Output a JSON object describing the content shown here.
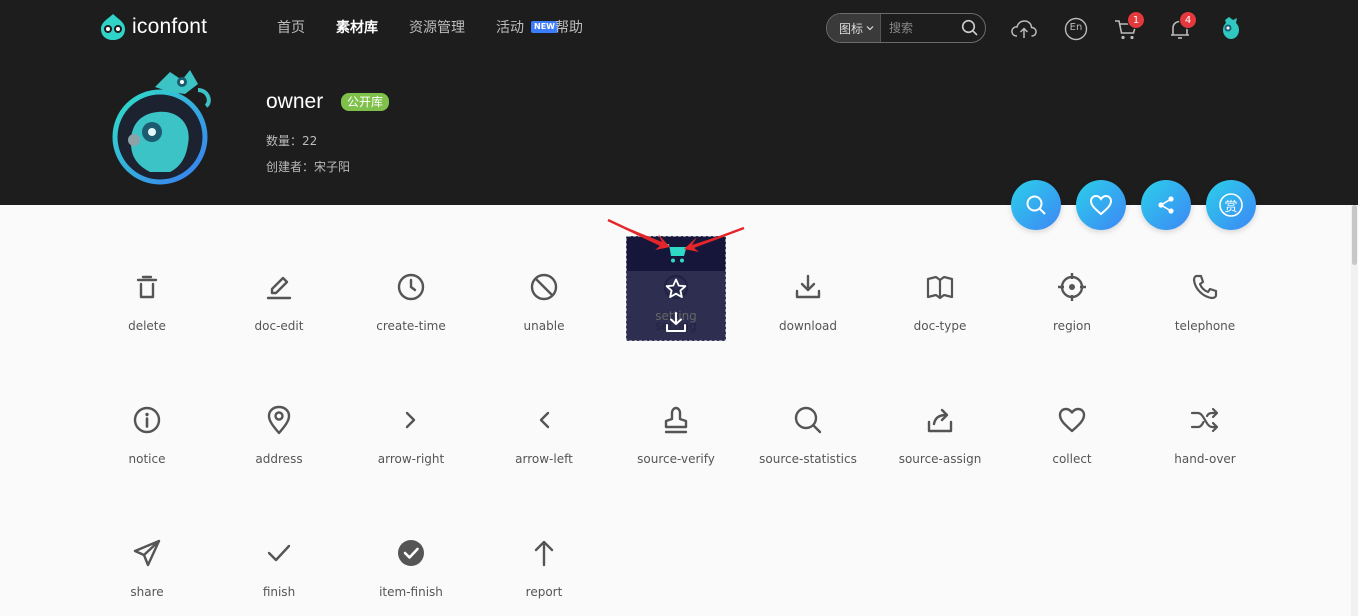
{
  "logo": {
    "text": "iconfont"
  },
  "nav": [
    {
      "label": "首页",
      "active": false
    },
    {
      "label": "素材库",
      "active": true
    },
    {
      "label": "资源管理",
      "active": false
    },
    {
      "label": "活动",
      "active": false,
      "badge": "NEW"
    },
    {
      "label": "帮助",
      "active": false
    }
  ],
  "search": {
    "type_label": "图标",
    "placeholder": "搜索"
  },
  "header_icons": {
    "upload": "cloud-upload-icon",
    "language_label": "En",
    "cart_count": "1",
    "notify_count": "4"
  },
  "profile": {
    "name": "owner",
    "badge": "公开库",
    "count": "数量：22",
    "creator": "创建者：宋子阳"
  },
  "actions": [
    "search-icon",
    "heart-icon",
    "share-icon",
    "reward-icon"
  ],
  "actions_reward_label": "赏",
  "icons": [
    {
      "label": "delete",
      "icon": "trash-icon"
    },
    {
      "label": "doc-edit",
      "icon": "pen-icon"
    },
    {
      "label": "create-time",
      "icon": "clock-icon"
    },
    {
      "label": "unable",
      "icon": "ban-icon"
    },
    {
      "label": "setting",
      "icon": "setting-icon",
      "hovered": true
    },
    {
      "label": "download",
      "icon": "download-icon"
    },
    {
      "label": "doc-type",
      "icon": "book-icon"
    },
    {
      "label": "region",
      "icon": "crosshair-icon"
    },
    {
      "label": "telephone",
      "icon": "phone-icon"
    },
    {
      "label": "notice",
      "icon": "info-icon"
    },
    {
      "label": "address",
      "icon": "map-pin-icon"
    },
    {
      "label": "arrow-right",
      "icon": "chevron-right-icon"
    },
    {
      "label": "arrow-left",
      "icon": "chevron-left-icon"
    },
    {
      "label": "source-verify",
      "icon": "stamp-icon"
    },
    {
      "label": "source-statistics",
      "icon": "magnifier-icon"
    },
    {
      "label": "source-assign",
      "icon": "share-out-icon"
    },
    {
      "label": "collect",
      "icon": "heart-outline-icon"
    },
    {
      "label": "hand-over",
      "icon": "shuffle-icon"
    },
    {
      "label": "share",
      "icon": "paper-plane-icon"
    },
    {
      "label": "finish",
      "icon": "check-icon"
    },
    {
      "label": "item-finish",
      "icon": "check-circle-icon"
    },
    {
      "label": "report",
      "icon": "arrow-up-icon"
    }
  ],
  "colors": {
    "header_bg": "#1d1d1d",
    "accent_gradient_start": "#2bd0ea",
    "accent_gradient_end": "#3d86f5",
    "public_badge": "#7fc04a",
    "count_badge": "#e4393c",
    "hover_overlay": "#1e1e44",
    "cart_teal": "#30d8c8"
  }
}
